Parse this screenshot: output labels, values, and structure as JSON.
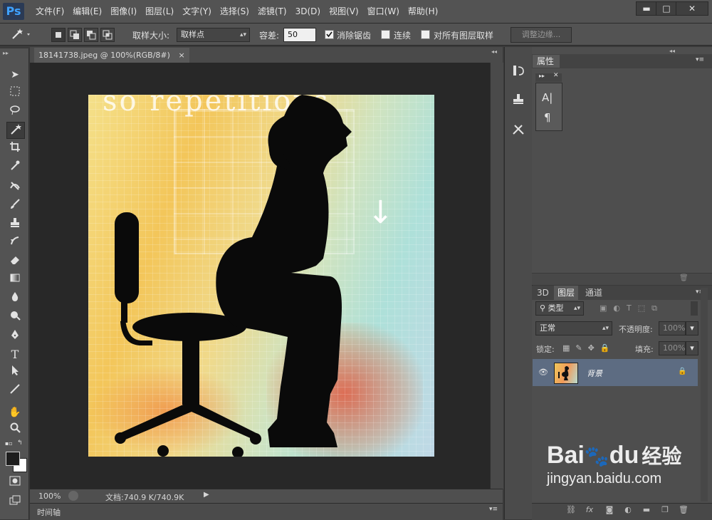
{
  "app": {
    "logo": "Ps"
  },
  "menu": [
    "文件(F)",
    "编辑(E)",
    "图像(I)",
    "图层(L)",
    "文字(Y)",
    "选择(S)",
    "滤镜(T)",
    "3D(D)",
    "视图(V)",
    "窗口(W)",
    "帮助(H)"
  ],
  "window_controls": {
    "minimize": "▬",
    "maximize": "□",
    "close": "✕"
  },
  "options_bar": {
    "sample_size_label": "取样大小:",
    "sample_size_value": "取样点",
    "tolerance_label": "容差:",
    "tolerance_value": "50",
    "antialias_label": "消除锯齿",
    "antialias_checked": true,
    "contiguous_label": "连续",
    "contiguous_checked": false,
    "all_layers_label": "对所有图层取样",
    "all_layers_checked": false,
    "refine_edge_button": "调整边缘..."
  },
  "document": {
    "tab_title": "18141738.jpeg @ 100%(RGB/8#)",
    "tab_close": "×",
    "image_text": "so repetitions"
  },
  "status_bar": {
    "zoom": "100%",
    "doc_info": "文档:740.9 K/740.9K"
  },
  "timeline_label": "时间轴",
  "properties_panel": {
    "tab": "属性"
  },
  "layers_panel": {
    "tabs": [
      "3D",
      "图层",
      "通道"
    ],
    "active_tab": "图层",
    "filter_kind": "类型",
    "blend_mode": "正常",
    "opacity_label": "不透明度:",
    "opacity_value": "100%",
    "lock_label": "锁定:",
    "fill_label": "填充:",
    "fill_value": "100%",
    "layers": [
      {
        "name": "背景",
        "visible": true,
        "locked": true
      }
    ]
  },
  "watermark": {
    "brand": "Bai",
    "brand_suffix": "du",
    "cn": "经验",
    "url": "jingyan.baidu.com"
  },
  "colors": {
    "accent": "#3fa2ff",
    "panel_bg": "#535353",
    "canvas_bg": "#282828",
    "selected_layer": "#5d6c82"
  }
}
